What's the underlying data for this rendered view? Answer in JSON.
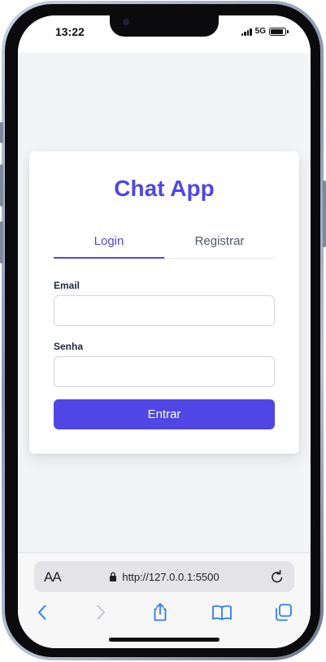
{
  "status_bar": {
    "time": "13:22",
    "network": "5G",
    "battery_level": 0.9
  },
  "app": {
    "title": "Chat App",
    "tabs": [
      {
        "label": "Login",
        "active": true
      },
      {
        "label": "Registrar",
        "active": false
      }
    ],
    "form": {
      "email_label": "Email",
      "email_value": "",
      "password_label": "Senha",
      "password_value": "",
      "submit_label": "Entrar"
    }
  },
  "browser": {
    "text_size_label": "AA",
    "url": "http://127.0.0.1:5500",
    "icons": [
      "text-size-icon",
      "lock-icon",
      "reload-icon",
      "back-icon",
      "forward-icon",
      "share-icon",
      "bookmarks-icon",
      "tabs-icon"
    ]
  },
  "colors": {
    "accent": "#4f46e5",
    "browser_icons": "#2f7cf6",
    "page_background": "#f3f4f6"
  }
}
